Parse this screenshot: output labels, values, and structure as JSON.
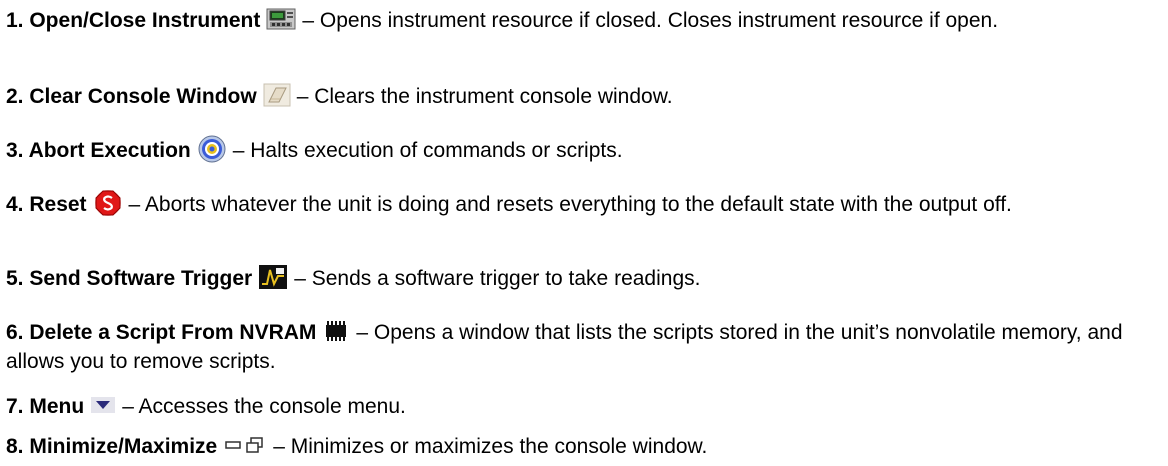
{
  "items": [
    {
      "title": "1. Open/Close Instrument",
      "icon": "instrument-panel-icon",
      "desc": "– Opens instrument resource if closed. Closes instrument resource if open."
    },
    {
      "title": "2. Clear Console Window",
      "icon": "eraser-icon",
      "desc": "– Clears the instrument console window."
    },
    {
      "title": "3. Abort Execution",
      "icon": "target-icon",
      "desc": "– Halts execution of commands or scripts."
    },
    {
      "title": "4. Reset",
      "icon": "stop-sign-icon",
      "desc": "– Aborts whatever the unit is doing and resets everything to the default state with the output off."
    },
    {
      "title": "5. Send Software Trigger",
      "icon": "trigger-icon",
      "desc": "– Sends a software trigger to take readings."
    },
    {
      "title": "6. Delete a Script From NVRAM",
      "icon": "memory-chip-icon",
      "desc": "– Opens a window that lists the scripts stored in the unit’s nonvolatile memory, and allows you to remove scripts."
    },
    {
      "title": "7. Menu",
      "icon": "menu-triangle-icon",
      "desc": "– Accesses the console menu."
    },
    {
      "title": "8. Minimize/Maximize",
      "icon": "minimize-maximize-icon",
      "desc": "– Minimizes or maximizes the console window."
    }
  ]
}
